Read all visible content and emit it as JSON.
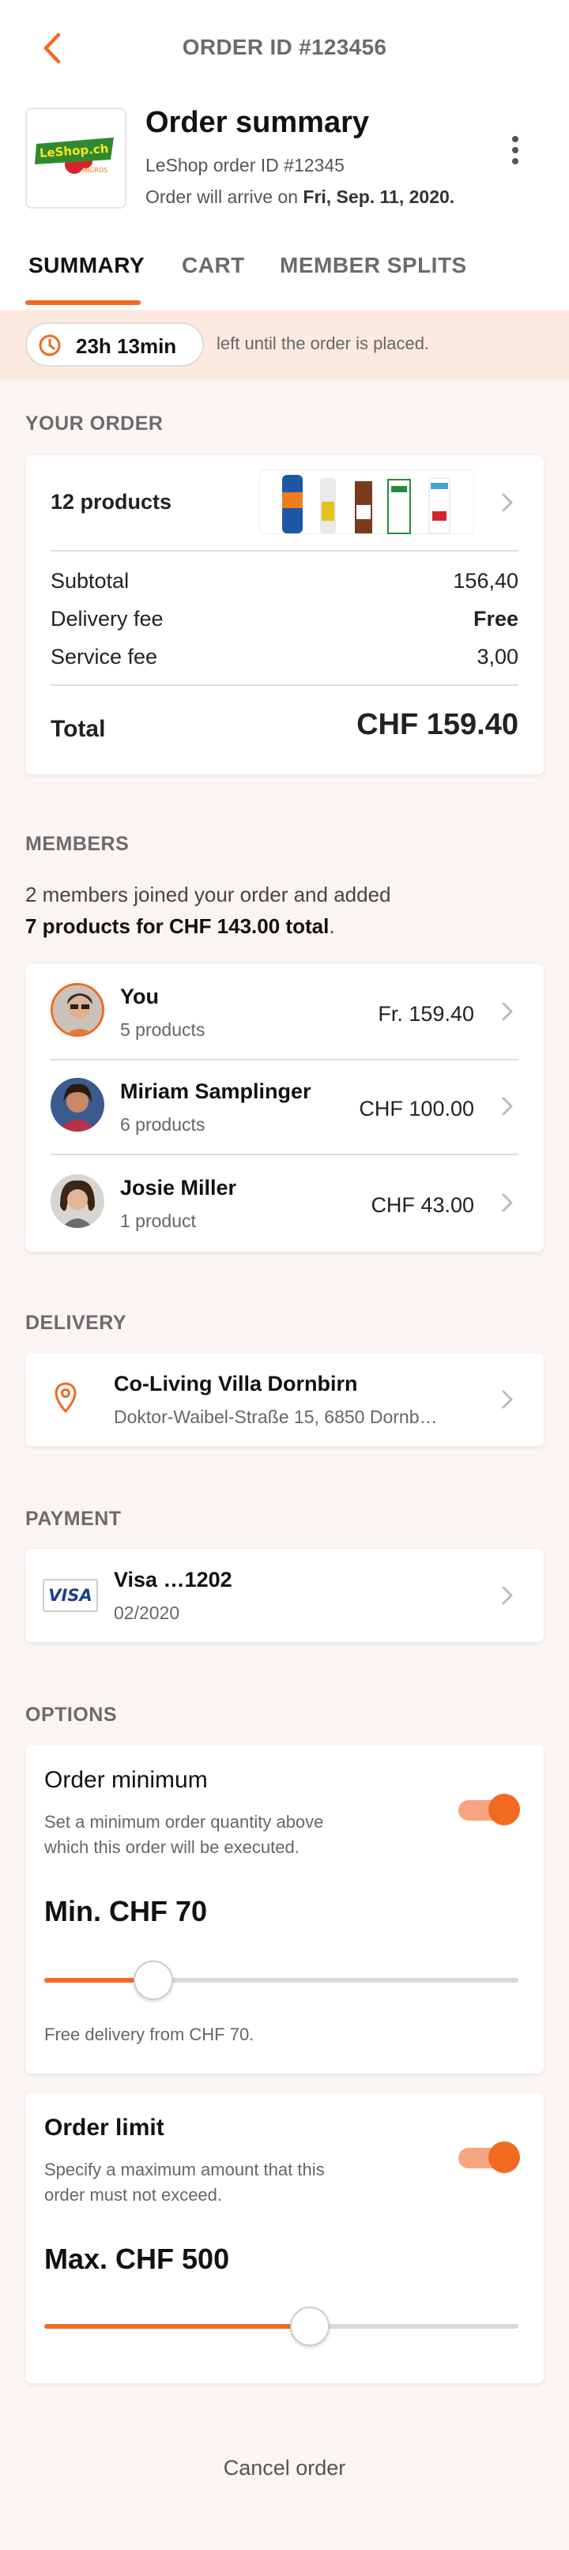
{
  "topbar": {
    "title": "ORDER ID #123456"
  },
  "header": {
    "title": "Order summary",
    "shop_order_id": "LeShop order ID #12345",
    "arrival_prefix": "Order will arrive on ",
    "arrival_date": "Fri, Sep. 11, 2020.",
    "logo_text": "LeShop.ch"
  },
  "tabs": [
    {
      "label": "SUMMARY",
      "active": true
    },
    {
      "label": "CART",
      "active": false
    },
    {
      "label": "MEMBER SPLITS",
      "active": false
    }
  ],
  "timer": {
    "value": "23h 13min",
    "description": "left until the order is placed."
  },
  "your_order": {
    "section_title": "YOUR ORDER",
    "products_label": "12 products",
    "rows": [
      {
        "label": "Subtotal",
        "value": "156,40",
        "bold": false
      },
      {
        "label": "Delivery fee",
        "value": "Free",
        "bold": true
      },
      {
        "label": "Service fee",
        "value": "3,00",
        "bold": false
      }
    ],
    "total_label": "Total",
    "total_value": "CHF 159.40"
  },
  "members": {
    "section_title": "MEMBERS",
    "summary_line1": "2 members joined your order and added",
    "summary_bold": "7 products for CHF 143.00 total",
    "summary_end": ".",
    "list": [
      {
        "name": "You",
        "products": "5 products",
        "amount": "Fr. 159.40"
      },
      {
        "name": "Miriam Samplinger",
        "products": "6 products",
        "amount": "CHF 100.00"
      },
      {
        "name": "Josie Miller",
        "products": "1 product",
        "amount": "CHF 43.00"
      }
    ]
  },
  "delivery": {
    "section_title": "DELIVERY",
    "name": "Co-Living Villa Dornbirn",
    "address": "Doktor-Waibel-Straße 15, 6850 Dornb…"
  },
  "payment": {
    "section_title": "PAYMENT",
    "card": "Visa …1202",
    "expiry": "02/2020",
    "brand": "VISA"
  },
  "options": {
    "section_title": "OPTIONS",
    "order_minimum": {
      "title": "Order minimum",
      "description_line1": "Set a minimum order quantity above",
      "description_line2": "which this order will be executed.",
      "value_label": "Min. CHF 70",
      "slider_fraction": 0.23,
      "note": "Free delivery from CHF 70.",
      "enabled": true
    },
    "order_limit": {
      "title": "Order limit",
      "description_line1": "Specify a maximum amount that this",
      "description_line2": "order must not exceed.",
      "value_label": "Max. CHF 500",
      "slider_fraction": 0.56,
      "enabled": true
    }
  },
  "cancel_label": "Cancel order",
  "colors": {
    "accent": "#f26a21",
    "banner": "#fde9df",
    "background": "#faf5f3"
  }
}
